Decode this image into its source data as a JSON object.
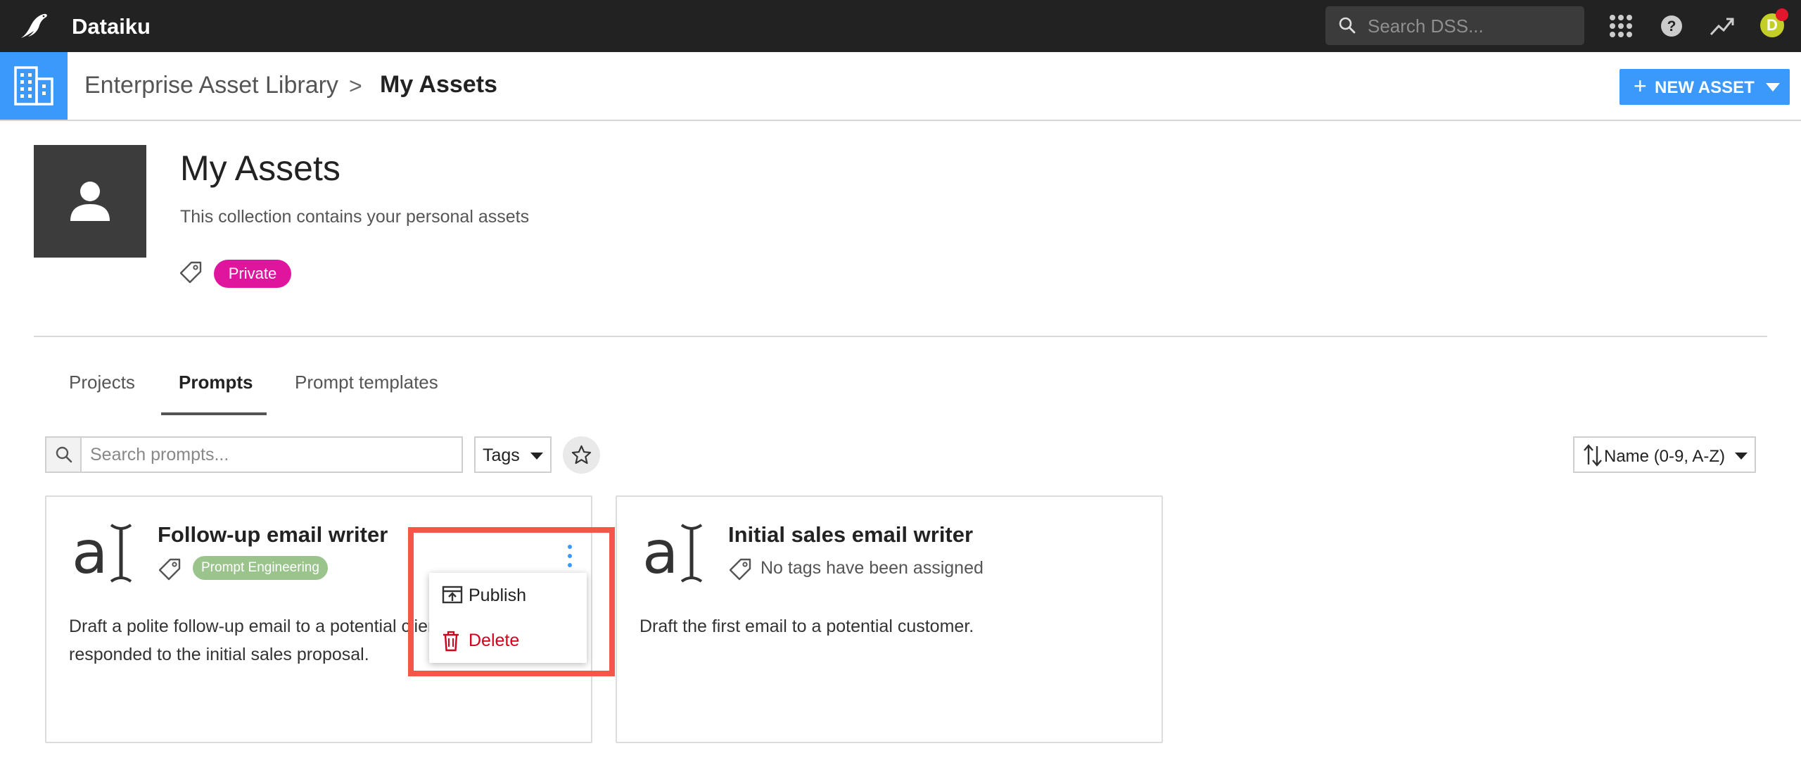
{
  "app": {
    "name": "Dataiku"
  },
  "topbar": {
    "search_placeholder": "Search DSS...",
    "icons": [
      "apps-grid-icon",
      "help-icon",
      "trending-icon",
      "user-avatar"
    ],
    "avatar_initial": "D"
  },
  "breadcrumb": {
    "parent": "Enterprise Asset Library",
    "separator": ">",
    "current": "My Assets"
  },
  "new_asset_button": {
    "label": "NEW ASSET",
    "icon": "+"
  },
  "collection": {
    "title": "My Assets",
    "description": "This collection contains your personal assets",
    "tag": "Private"
  },
  "tabs": [
    {
      "label": "Projects",
      "active": false
    },
    {
      "label": "Prompts",
      "active": true
    },
    {
      "label": "Prompt templates",
      "active": false
    }
  ],
  "filters": {
    "search_placeholder": "Search prompts...",
    "search_value": "",
    "tags_label": "Tags",
    "sort_label": "Name (0-9, A-Z)"
  },
  "cards": [
    {
      "title": "Follow-up email writer",
      "tag": "Prompt Engineering",
      "description": "Draft a polite follow-up email to a potential client who has not responded to the initial sales proposal."
    },
    {
      "title": "Initial sales email writer",
      "no_tags_text": "No tags have been assigned",
      "description": "Draft the first email to a potential customer."
    }
  ],
  "context_menu": {
    "items": [
      {
        "label": "Publish",
        "icon": "publish-icon"
      },
      {
        "label": "Delete",
        "icon": "trash-icon"
      }
    ]
  },
  "colors": {
    "topbar": "#222222",
    "accent_blue": "#3b99fc",
    "private_badge": "#e0159e",
    "tag_green": "#9bc48d",
    "delete_red": "#d0021b",
    "highlight": "#f2574a",
    "avatar": "#c3cf27"
  }
}
